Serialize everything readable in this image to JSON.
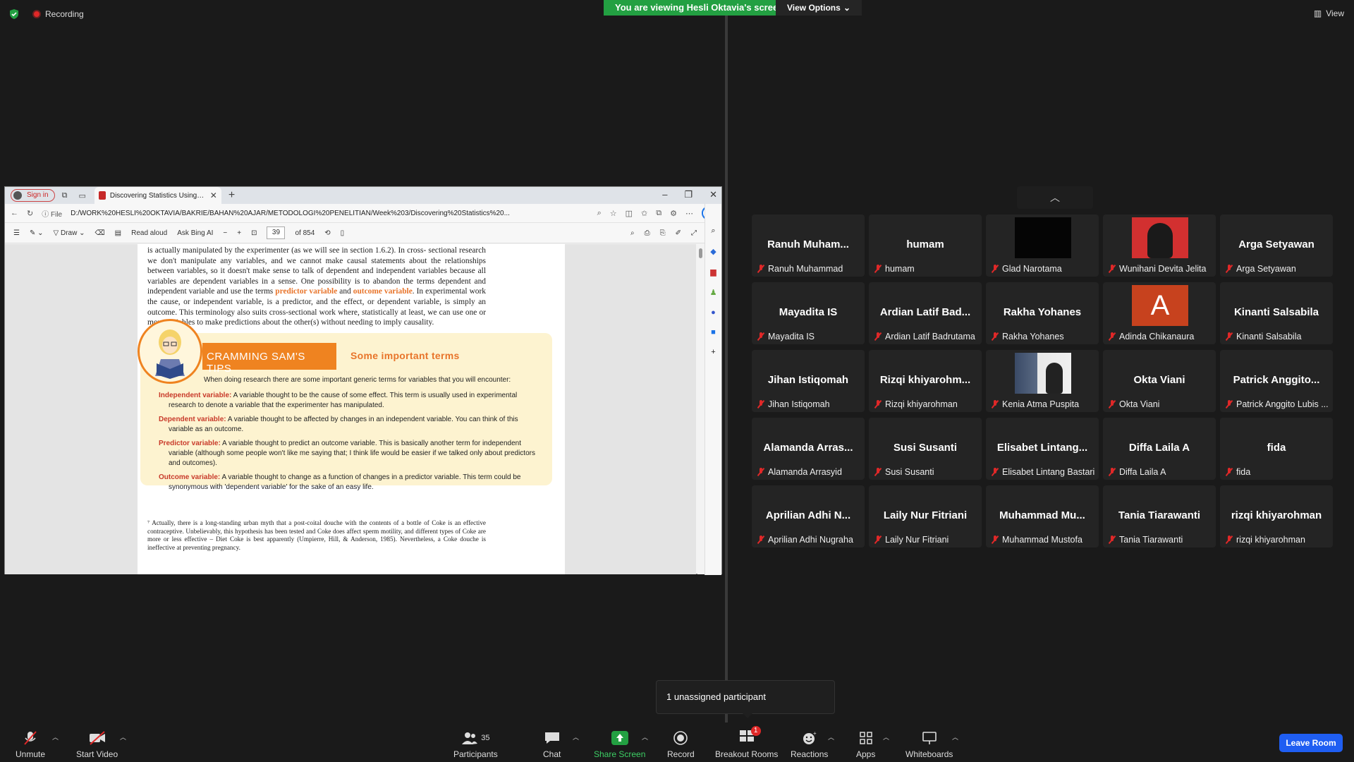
{
  "top": {
    "recording": "Recording",
    "viewing_banner": "You are viewing Hesli Oktavia's screen",
    "view_options": "View Options",
    "view": "View"
  },
  "browser": {
    "signin": "Sign in",
    "tab_title": "Discovering Statistics Using SPSS",
    "file_chip": "File",
    "url": "D:/WORK%20HESLI%20OKTAVIA/BAKRIE/BAHAN%20AJAR/METODOLOGI%20PENELITIAN/Week%203/Discovering%20Statistics%20...",
    "toolbar": {
      "draw": "Draw",
      "read_aloud": "Read aloud",
      "ask_bing": "Ask Bing AI",
      "page": "39",
      "of_pages": "of 854"
    }
  },
  "pdf": {
    "para_lines": [
      "is actually manipulated by the experimenter (as we will see in section 1.6.2). In cross-",
      "sectional research we don't manipulate any variables, and we cannot make causal statements about the relationships between variables, so it doesn't make sense to talk of dependent and independent variables because all variables are dependent variables in a sense. One possibility is to abandon the terms dependent and independent variable and use the terms"
    ],
    "term_predictor": "predictor variable",
    "and": "and",
    "term_outcome": "outcome variable",
    "para_rest": ". In experimental work the cause, or independent variable, is a predictor, and the effect, or dependent variable, is simply an outcome. This terminology also suits cross-sectional work where, statistically at least, we can use one or more variables to make predictions about the other(s) without needing to imply causality.",
    "tip_title": "CRAMMING SAM'S TIPS",
    "tip_subtitle": "Some important terms",
    "tip_intro": "When doing research there are some important generic terms for variables that you will encounter:",
    "terms": [
      {
        "term": "Independent variable:",
        "def": "A variable thought to be the cause of some effect. This term is usually used in experimental research to denote a variable that the experimenter has manipulated."
      },
      {
        "term": "Dependent variable:",
        "def": "A variable thought to be affected by changes in an independent variable. You can think of this variable as an outcome."
      },
      {
        "term": "Predictor variable:",
        "def": "A variable thought to predict an outcome variable. This is basically another term for independent variable (although some people won't like me saying that; I think life would be easier if we talked only about predictors and outcomes)."
      },
      {
        "term": "Outcome variable:",
        "def": "A variable thought to change as a function of changes in a predictor variable. This term could be synonymous with 'dependent variable' for the sake of an easy life."
      }
    ],
    "footnote": "⁷ Actually, there is a long-standing urban myth that a post-coital douche with the contents of a bottle of Coke is an effective contraceptive. Unbelievably, this hypothesis has been tested and Coke does affect sperm motility, and different types of Coke are more or less effective – Diet Coke is best apparently (Umpierre, Hill, & Anderson, 1985). Nevertheless, a Coke douche is ineffective at preventing pregnancy."
  },
  "participants": [
    {
      "title": "Ranuh  Muham...",
      "name": "Ranuh Muhammad",
      "thumb": "none"
    },
    {
      "title": "humam",
      "name": "humam",
      "thumb": "none"
    },
    {
      "title": "",
      "name": "Glad Narotama",
      "thumb": "black"
    },
    {
      "title": "",
      "name": "Wunihani Devita Jelita",
      "thumb": "photo"
    },
    {
      "title": "Arga Setyawan",
      "name": "Arga Setyawan",
      "thumb": "none"
    },
    {
      "title": "Mayadita IS",
      "name": "Mayadita IS",
      "thumb": "none"
    },
    {
      "title": "Ardian  Latif  Bad...",
      "name": "Ardian Latif Badrutama",
      "thumb": "none"
    },
    {
      "title": "Rakha  Yohanes",
      "name": "Rakha Yohanes",
      "thumb": "none"
    },
    {
      "title": "",
      "name": "Adinda Chikanaura",
      "thumb": "avatar-a",
      "avatar_letter": "A"
    },
    {
      "title": "Kinanti  Salsabila",
      "name": "Kinanti Salsabila",
      "thumb": "none"
    },
    {
      "title": "Jihan  Istiqomah",
      "name": "Jihan Istiqomah",
      "thumb": "none"
    },
    {
      "title": "Rizqi  khiyarohm...",
      "name": "Rizqi khiyarohman",
      "thumb": "none"
    },
    {
      "title": "",
      "name": "Kenia Atma Puspita",
      "thumb": "room"
    },
    {
      "title": "Okta  Viani",
      "name": "Okta Viani",
      "thumb": "none"
    },
    {
      "title": "Patrick  Anggito...",
      "name": "Patrick Anggito Lubis ...",
      "thumb": "none"
    },
    {
      "title": "Alamanda  Arras...",
      "name": "Alamanda Arrasyid",
      "thumb": "none"
    },
    {
      "title": "Susi  Susanti",
      "name": "Susi Susanti",
      "thumb": "none"
    },
    {
      "title": "Elisabet  Lintang...",
      "name": "Elisabet Lintang Bastari",
      "thumb": "none"
    },
    {
      "title": "Diffa  Laila  A",
      "name": "Diffa Laila A",
      "thumb": "none"
    },
    {
      "title": "fida",
      "name": "fida",
      "thumb": "none"
    },
    {
      "title": "Aprilian  Adhi  N...",
      "name": "Aprilian Adhi Nugraha",
      "thumb": "none"
    },
    {
      "title": "Laily  Nur  Fitriani",
      "name": "Laily Nur Fitriani",
      "thumb": "none"
    },
    {
      "title": "Muhammad  Mu...",
      "name": "Muhammad Mustofa",
      "thumb": "none"
    },
    {
      "title": "Tania  Tiarawanti",
      "name": "Tania Tiarawanti",
      "thumb": "none"
    },
    {
      "title": "rizqi  khiyarohman",
      "name": "rizqi khiyarohman",
      "thumb": "none"
    }
  ],
  "tooltip": "1 unassigned participant",
  "toolbar": {
    "unmute": "Unmute",
    "start_video": "Start Video",
    "participants": "Participants",
    "participants_count": "35",
    "chat": "Chat",
    "share_screen": "Share Screen",
    "record": "Record",
    "breakout_rooms": "Breakout Rooms",
    "breakout_badge": "1",
    "reactions": "Reactions",
    "apps": "Apps",
    "whiteboards": "Whiteboards",
    "leave_room": "Leave Room"
  },
  "colors": {
    "banner_green": "#23a042",
    "leave_blue": "#1f5ef2",
    "mute_red": "#e02828",
    "tip_orange": "#ef8320"
  }
}
